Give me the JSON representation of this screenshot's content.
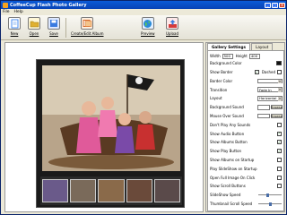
{
  "window": {
    "title": "CoffeeCup Flash Photo Gallery"
  },
  "menu": [
    "File",
    "Help"
  ],
  "toolbar": [
    {
      "label": "New",
      "icon": "new-document-icon",
      "color": "#4a8ef0"
    },
    {
      "label": "Open",
      "icon": "open-folder-icon",
      "color": "#e0b030"
    },
    {
      "label": "Save",
      "icon": "save-disk-icon",
      "color": "#3a7ae0"
    },
    {
      "label": "Create/Edit Album",
      "icon": "album-edit-icon",
      "color": "#d66a2a"
    },
    {
      "label": "Preview",
      "icon": "globe-preview-icon",
      "color": "#2a8ad8"
    },
    {
      "label": "Upload",
      "icon": "upload-icon",
      "color": "#d63a3a"
    }
  ],
  "panel": {
    "tabs": [
      "Gallery Settings",
      "Layout"
    ],
    "width_label": "Width",
    "width_value": "500",
    "height_label": "Height",
    "height_value": "400",
    "rows": [
      {
        "label": "Background Color",
        "kind": "swatch",
        "color": "#111111"
      },
      {
        "label": "Show Border",
        "kind": "check-dashed",
        "checked": true,
        "extra": "Dashed"
      },
      {
        "label": "Border Color",
        "kind": "select",
        "value": ""
      },
      {
        "label": "Transition",
        "kind": "select",
        "value": "Fade In"
      },
      {
        "label": "Layout",
        "kind": "select",
        "value": "Horizontal"
      },
      {
        "label": "Background Sound",
        "kind": "browse",
        "value": "Browse"
      },
      {
        "label": "Mouse Over Sound",
        "kind": "browse",
        "value": "Browse"
      },
      {
        "label": "Don't Play Any Sounds",
        "kind": "check",
        "checked": false
      },
      {
        "label": "Show Audio Button",
        "kind": "check",
        "checked": true
      },
      {
        "label": "Show Albums Button",
        "kind": "check",
        "checked": true
      },
      {
        "label": "Show Play Button",
        "kind": "check",
        "checked": true
      },
      {
        "label": "Show Albums on Startup",
        "kind": "check",
        "checked": false
      },
      {
        "label": "Play SlideShow on Startup",
        "kind": "check",
        "checked": false
      },
      {
        "label": "Open Full Image On Click",
        "kind": "check",
        "checked": false
      },
      {
        "label": "Show Scroll Buttons",
        "kind": "check",
        "checked": false
      },
      {
        "label": "SlideShow Speed",
        "kind": "slider",
        "level": 0.4
      },
      {
        "label": "Thumbnail Scroll Speed",
        "kind": "slider",
        "level": 0.5
      }
    ]
  },
  "colors": {
    "accent": "#0a5bd8",
    "panel": "#ece9d8",
    "stage": "#1a1a1a"
  }
}
